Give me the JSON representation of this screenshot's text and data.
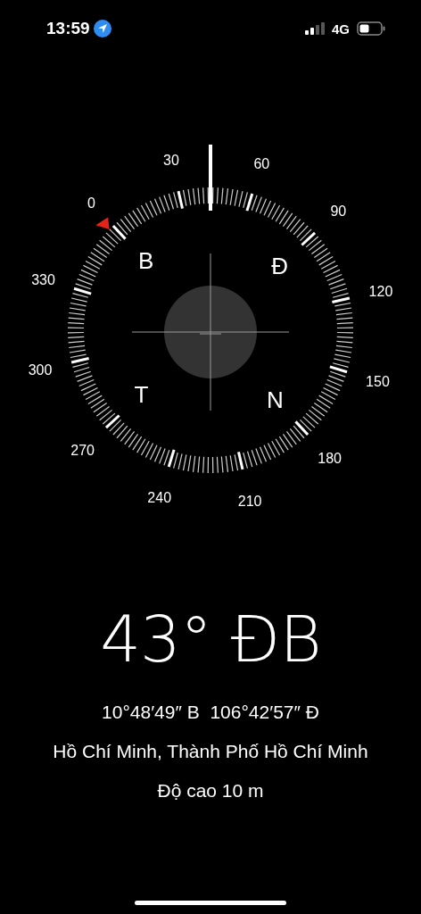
{
  "status_bar": {
    "time": "13:59",
    "network": "4G"
  },
  "compass": {
    "degree_labels": [
      "0",
      "30",
      "60",
      "90",
      "120",
      "150",
      "180",
      "210",
      "240",
      "270",
      "300",
      "330"
    ],
    "cardinals": [
      "B",
      "Đ",
      "T",
      "N"
    ]
  },
  "heading": "43° ĐB",
  "coordinates": "10°48′49″ B  106°42′57″ Đ",
  "location": "Hồ Chí Minh, Thành Phố Hồ Chí Minh",
  "altitude": "Độ cao 10 m"
}
